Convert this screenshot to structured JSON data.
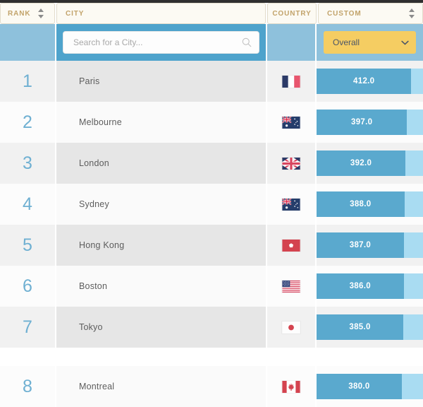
{
  "top_strip": {
    "color": "#2f2f2f"
  },
  "columns": [
    {
      "key": "rank",
      "label": "RANK",
      "sortable": true
    },
    {
      "key": "city",
      "label": "CITY",
      "sortable": false
    },
    {
      "key": "country",
      "label": "COUNTRY",
      "sortable": false
    },
    {
      "key": "custom",
      "label": "CUSTOM",
      "sortable": true
    }
  ],
  "search": {
    "placeholder": "Search for a City...",
    "value": "",
    "icon": "search-icon"
  },
  "custom_filter": {
    "selected": "Overall",
    "icon": "chevron-down-icon",
    "color": "#f5cd62"
  },
  "colors": {
    "header_text": "#c2a36a",
    "header_bg": "#fcfaf3",
    "band_primary": "#4ea3cc",
    "band_secondary": "#8ec1dc",
    "rank_text": "#6fb0d2",
    "bar_fill": "#5aa9ce",
    "bar_track": "#a9dcf2",
    "accent_yellow": "#f5cd62"
  },
  "chart_data": {
    "type": "bar",
    "title": "",
    "xlabel": "",
    "ylabel": "",
    "categories": [
      "Paris",
      "Melbourne",
      "London",
      "Sydney",
      "Hong Kong",
      "Boston",
      "Tokyo",
      "Montreal"
    ],
    "values": [
      412.0,
      397.0,
      392.0,
      388.0,
      387.0,
      386.0,
      385.0,
      380.0
    ],
    "value_labels": [
      "412.0",
      "397.0",
      "392.0",
      "388.0",
      "387.0",
      "386.0",
      "385.0",
      "380.0"
    ],
    "series": [
      {
        "name": "Overall",
        "values": [
          412.0,
          397.0,
          392.0,
          388.0,
          387.0,
          386.0,
          385.0,
          380.0
        ]
      }
    ],
    "orientation": "horizontal",
    "grid": false,
    "legend": "none"
  },
  "rows": [
    {
      "rank": "1",
      "city": "Paris",
      "country": "France",
      "flag": "flag-france",
      "value": "412.0",
      "bar_pct": 89.0
    },
    {
      "rank": "2",
      "city": "Melbourne",
      "country": "Australia",
      "flag": "flag-australia",
      "value": "397.0",
      "bar_pct": 85.0
    },
    {
      "rank": "3",
      "city": "London",
      "country": "United Kingdom",
      "flag": "flag-united-kingdom",
      "value": "392.0",
      "bar_pct": 83.5
    },
    {
      "rank": "4",
      "city": "Sydney",
      "country": "Australia",
      "flag": "flag-australia",
      "value": "388.0",
      "bar_pct": 82.5
    },
    {
      "rank": "5",
      "city": "Hong Kong",
      "country": "Hong Kong",
      "flag": "flag-hong-kong",
      "value": "387.0",
      "bar_pct": 82.0
    },
    {
      "rank": "6",
      "city": "Boston",
      "country": "United States",
      "flag": "flag-united-states",
      "value": "386.0",
      "bar_pct": 81.8
    },
    {
      "rank": "7",
      "city": "Tokyo",
      "country": "Japan",
      "flag": "flag-japan",
      "value": "385.0",
      "bar_pct": 81.5
    },
    {
      "rank": "8",
      "city": "Montreal",
      "country": "Canada",
      "flag": "flag-canada",
      "value": "380.0",
      "bar_pct": 80.0
    }
  ]
}
